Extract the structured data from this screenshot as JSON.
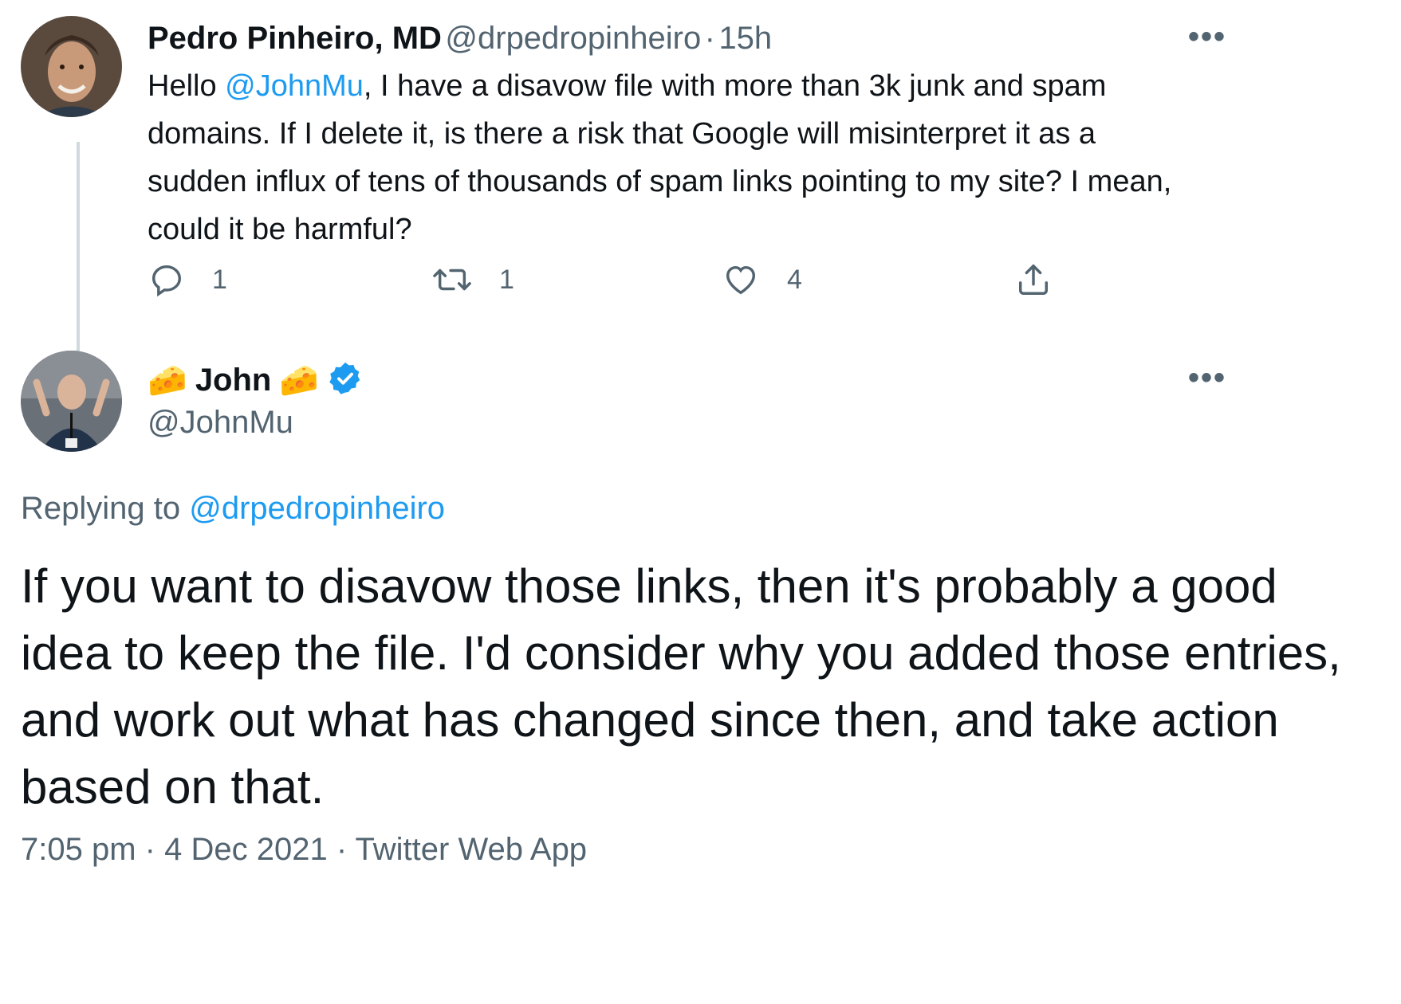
{
  "parent_tweet": {
    "author_name": "Pedro Pinheiro, MD",
    "author_handle": "@drpedropinheiro",
    "separator": "·",
    "time_ago": "15h",
    "text_before_mention": "Hello ",
    "mention": "@JohnMu",
    "text_after_mention": ", I have a disavow file with more than 3k junk and spam domains. If I delete it, is there a risk that Google will misinterpret it as a sudden influx of tens of thousands of spam links pointing to my site? I mean, could it be harmful?",
    "more_label": "•••",
    "actions": {
      "reply_count": "1",
      "retweet_count": "1",
      "like_count": "4"
    }
  },
  "reply_tweet": {
    "author_name": "John",
    "name_emoji": "🧀",
    "author_handle": "@JohnMu",
    "more_label": "•••",
    "replying_to_label": "Replying to ",
    "replying_to_handle": "@drpedropinheiro",
    "text": "If you want to disavow those links, then it's probably a good idea to keep the file. I'd consider why you added those entries, and work out what has changed since then, and take action based on that.",
    "time": "7:05 pm",
    "date": "4 Dec 2021",
    "source": "Twitter Web App",
    "meta_separator": "·"
  },
  "colors": {
    "accent": "#1d9bf0",
    "secondary_text": "#536471",
    "primary_text": "#0f1419",
    "verified": "#1d9bf0",
    "thread_line": "#cfd9de"
  },
  "icons": [
    "reply-icon",
    "retweet-icon",
    "like-icon",
    "share-icon",
    "verified-badge-icon",
    "cheese-icon",
    "more-icon"
  ]
}
